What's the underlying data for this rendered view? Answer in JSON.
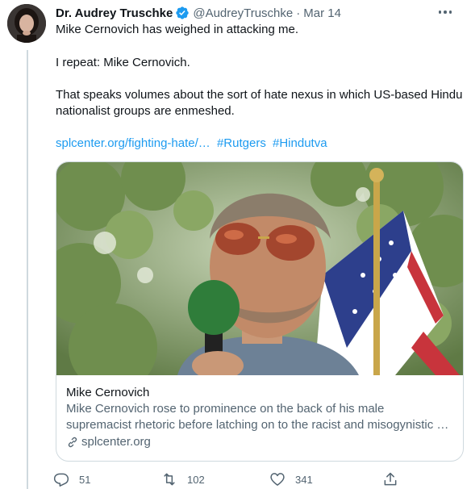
{
  "tweet": {
    "author_name": "Dr. Audrey Truschke",
    "handle": "@AudreyTruschke",
    "separator": "·",
    "date": "Mar 14",
    "paragraphs": [
      "Mike Cernovich has weighed in attacking me.",
      "I repeat: Mike Cernovich.",
      "That speaks volumes about the sort of hate nexus in which US-based Hindu",
      "nationalist groups are enmeshed."
    ],
    "link": "splcenter.org/fighting-hate/…",
    "hashtags": [
      "#Rutgers",
      "#Hindutva"
    ]
  },
  "card": {
    "title": "Mike Cernovich",
    "description_line1": "Mike Cernovich rose to prominence on the back of his male",
    "description_line2": "supremacist rhetoric before latching on to the racist and misogynistic …",
    "domain": "splcenter.org"
  },
  "actions": {
    "replies": "51",
    "retweets": "102",
    "likes": "341"
  },
  "icons": {
    "verified": "verified-badge-icon",
    "more": "more-options-icon",
    "reply": "reply-icon",
    "retweet": "retweet-icon",
    "like": "heart-icon",
    "share": "share-icon",
    "link": "link-icon"
  },
  "colors": {
    "link": "#1d9bf0",
    "secondary_text": "#536471",
    "border": "#cfd9de",
    "verified": "#1d9bf0"
  }
}
